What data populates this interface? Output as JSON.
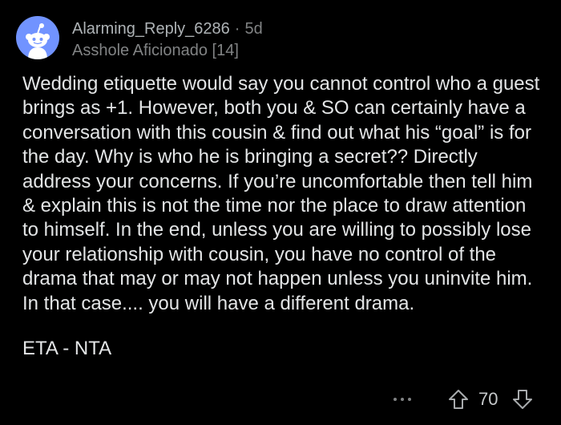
{
  "comment": {
    "username": "Alarming_Reply_6286",
    "separator": "·",
    "age": "5d",
    "flair": "Asshole Aficionado [14]",
    "body": "Wedding etiquette would say you cannot control who a guest brings as +1. However, both you & SO can certainly have a conversation with this cousin & find out what his “goal” is for the day. Why is who he is bringing a secret?? Directly address your concerns. If you’re uncomfortable then tell him & explain this is not the time nor the place to draw attention to himself. In the end, unless you are willing to possibly lose your relationship with cousin, you have no control of the drama that may or may not happen unless you uninvite him. In that case.... you will have a different drama.",
    "verdict": "ETA - NTA",
    "score": "70"
  },
  "icons": {
    "avatar": "snoo-avatar-icon",
    "more": "more-options-icon",
    "upvote": "upvote-arrow-icon",
    "downvote": "downvote-arrow-icon"
  },
  "colors": {
    "background": "#000000",
    "avatar": "#7193ff",
    "text": "#e3e5e6",
    "muted": "#818384"
  }
}
